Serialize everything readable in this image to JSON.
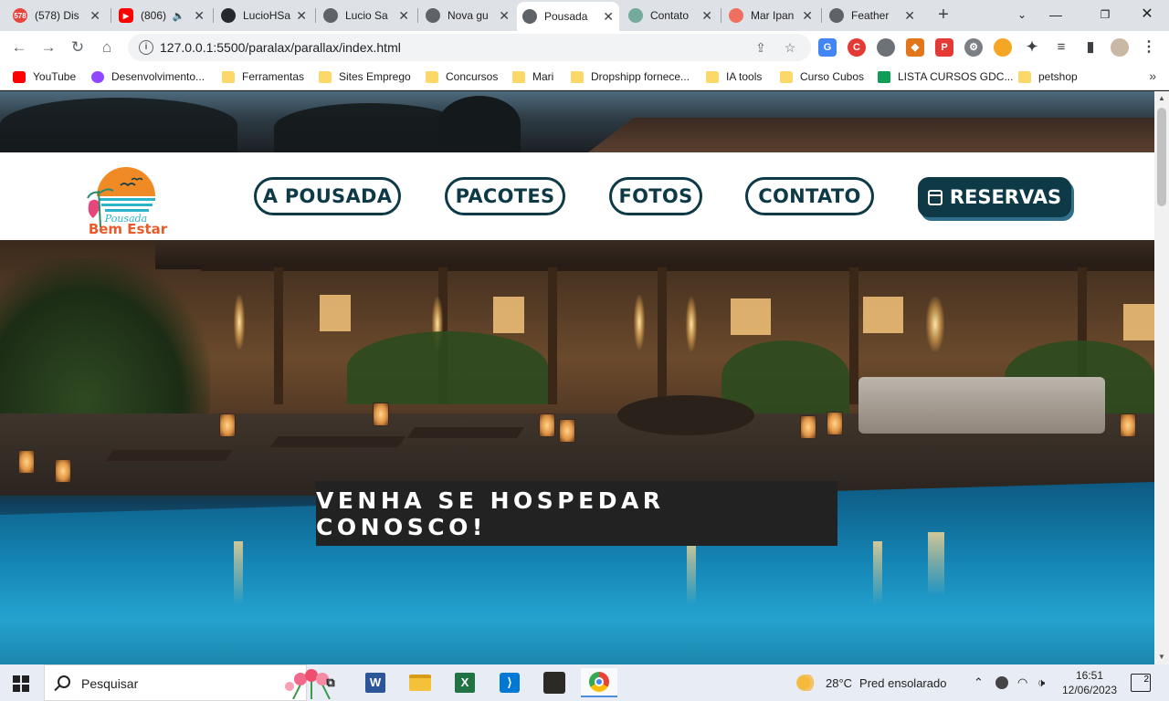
{
  "browser": {
    "tabs": [
      {
        "title": "(578) Dis",
        "favicon_color": "#e8453c",
        "favicon_text": "578",
        "active": false
      },
      {
        "title": "(806)",
        "favicon_color": "#ff0000",
        "favicon_text": "▶",
        "active": false,
        "muted_icon": "speaker-icon"
      },
      {
        "title": "LucioHSa",
        "favicon_color": "#24292f",
        "favicon_text": "",
        "active": false
      },
      {
        "title": "Lucio Sa",
        "favicon_color": "#5f6368",
        "favicon_text": "",
        "active": false
      },
      {
        "title": "Nova gu",
        "favicon_color": "#5f6368",
        "favicon_text": "",
        "active": false
      },
      {
        "title": "Pousada",
        "favicon_color": "#5f6368",
        "favicon_text": "",
        "active": true
      },
      {
        "title": "Contato",
        "favicon_color": "#74aa9c",
        "favicon_text": "",
        "active": false
      },
      {
        "title": "Mar Ipan",
        "favicon_color": "#f07060",
        "favicon_text": "",
        "active": false
      },
      {
        "title": "Feather",
        "favicon_color": "#5f6368",
        "favicon_text": "",
        "active": false
      }
    ],
    "new_tab_label": "+",
    "url": "127.0.0.1:5500/paralax/parallax/index.html",
    "bookmarks": [
      {
        "label": "YouTube",
        "icon": "youtube"
      },
      {
        "label": "Desenvolvimento...",
        "icon": "twitch"
      },
      {
        "label": "Ferramentas",
        "icon": "folder"
      },
      {
        "label": "Sites Emprego",
        "icon": "folder"
      },
      {
        "label": "Concursos",
        "icon": "folder"
      },
      {
        "label": "Mari",
        "icon": "folder"
      },
      {
        "label": "Dropshipp fornece...",
        "icon": "folder"
      },
      {
        "label": "IA tools",
        "icon": "folder"
      },
      {
        "label": "Curso Cubos",
        "icon": "folder"
      },
      {
        "label": "LISTA CURSOS GDC...",
        "icon": "sheets"
      },
      {
        "label": "petshop",
        "icon": "folder"
      }
    ]
  },
  "site": {
    "logo": {
      "line1": "Pousada",
      "line2": "Bem Estar"
    },
    "nav": [
      {
        "label": "A POUSADA"
      },
      {
        "label": "PACOTES"
      },
      {
        "label": "FOTOS"
      },
      {
        "label": "CONTATO"
      }
    ],
    "reserve_label": "RESERVAS",
    "hero_caption": "VENHA SE HOSPEDAR CONOSCO!",
    "colors": {
      "brand": "#0e3a48",
      "accent": "#2f6f8a",
      "sun": "#f08a24",
      "sea": "#2bb3c8"
    }
  },
  "taskbar": {
    "search_placeholder": "Pesquisar",
    "weather_temp": "28°C",
    "weather_text": "Pred ensolarado",
    "time": "16:51",
    "date": "12/06/2023",
    "notifications": "2"
  }
}
